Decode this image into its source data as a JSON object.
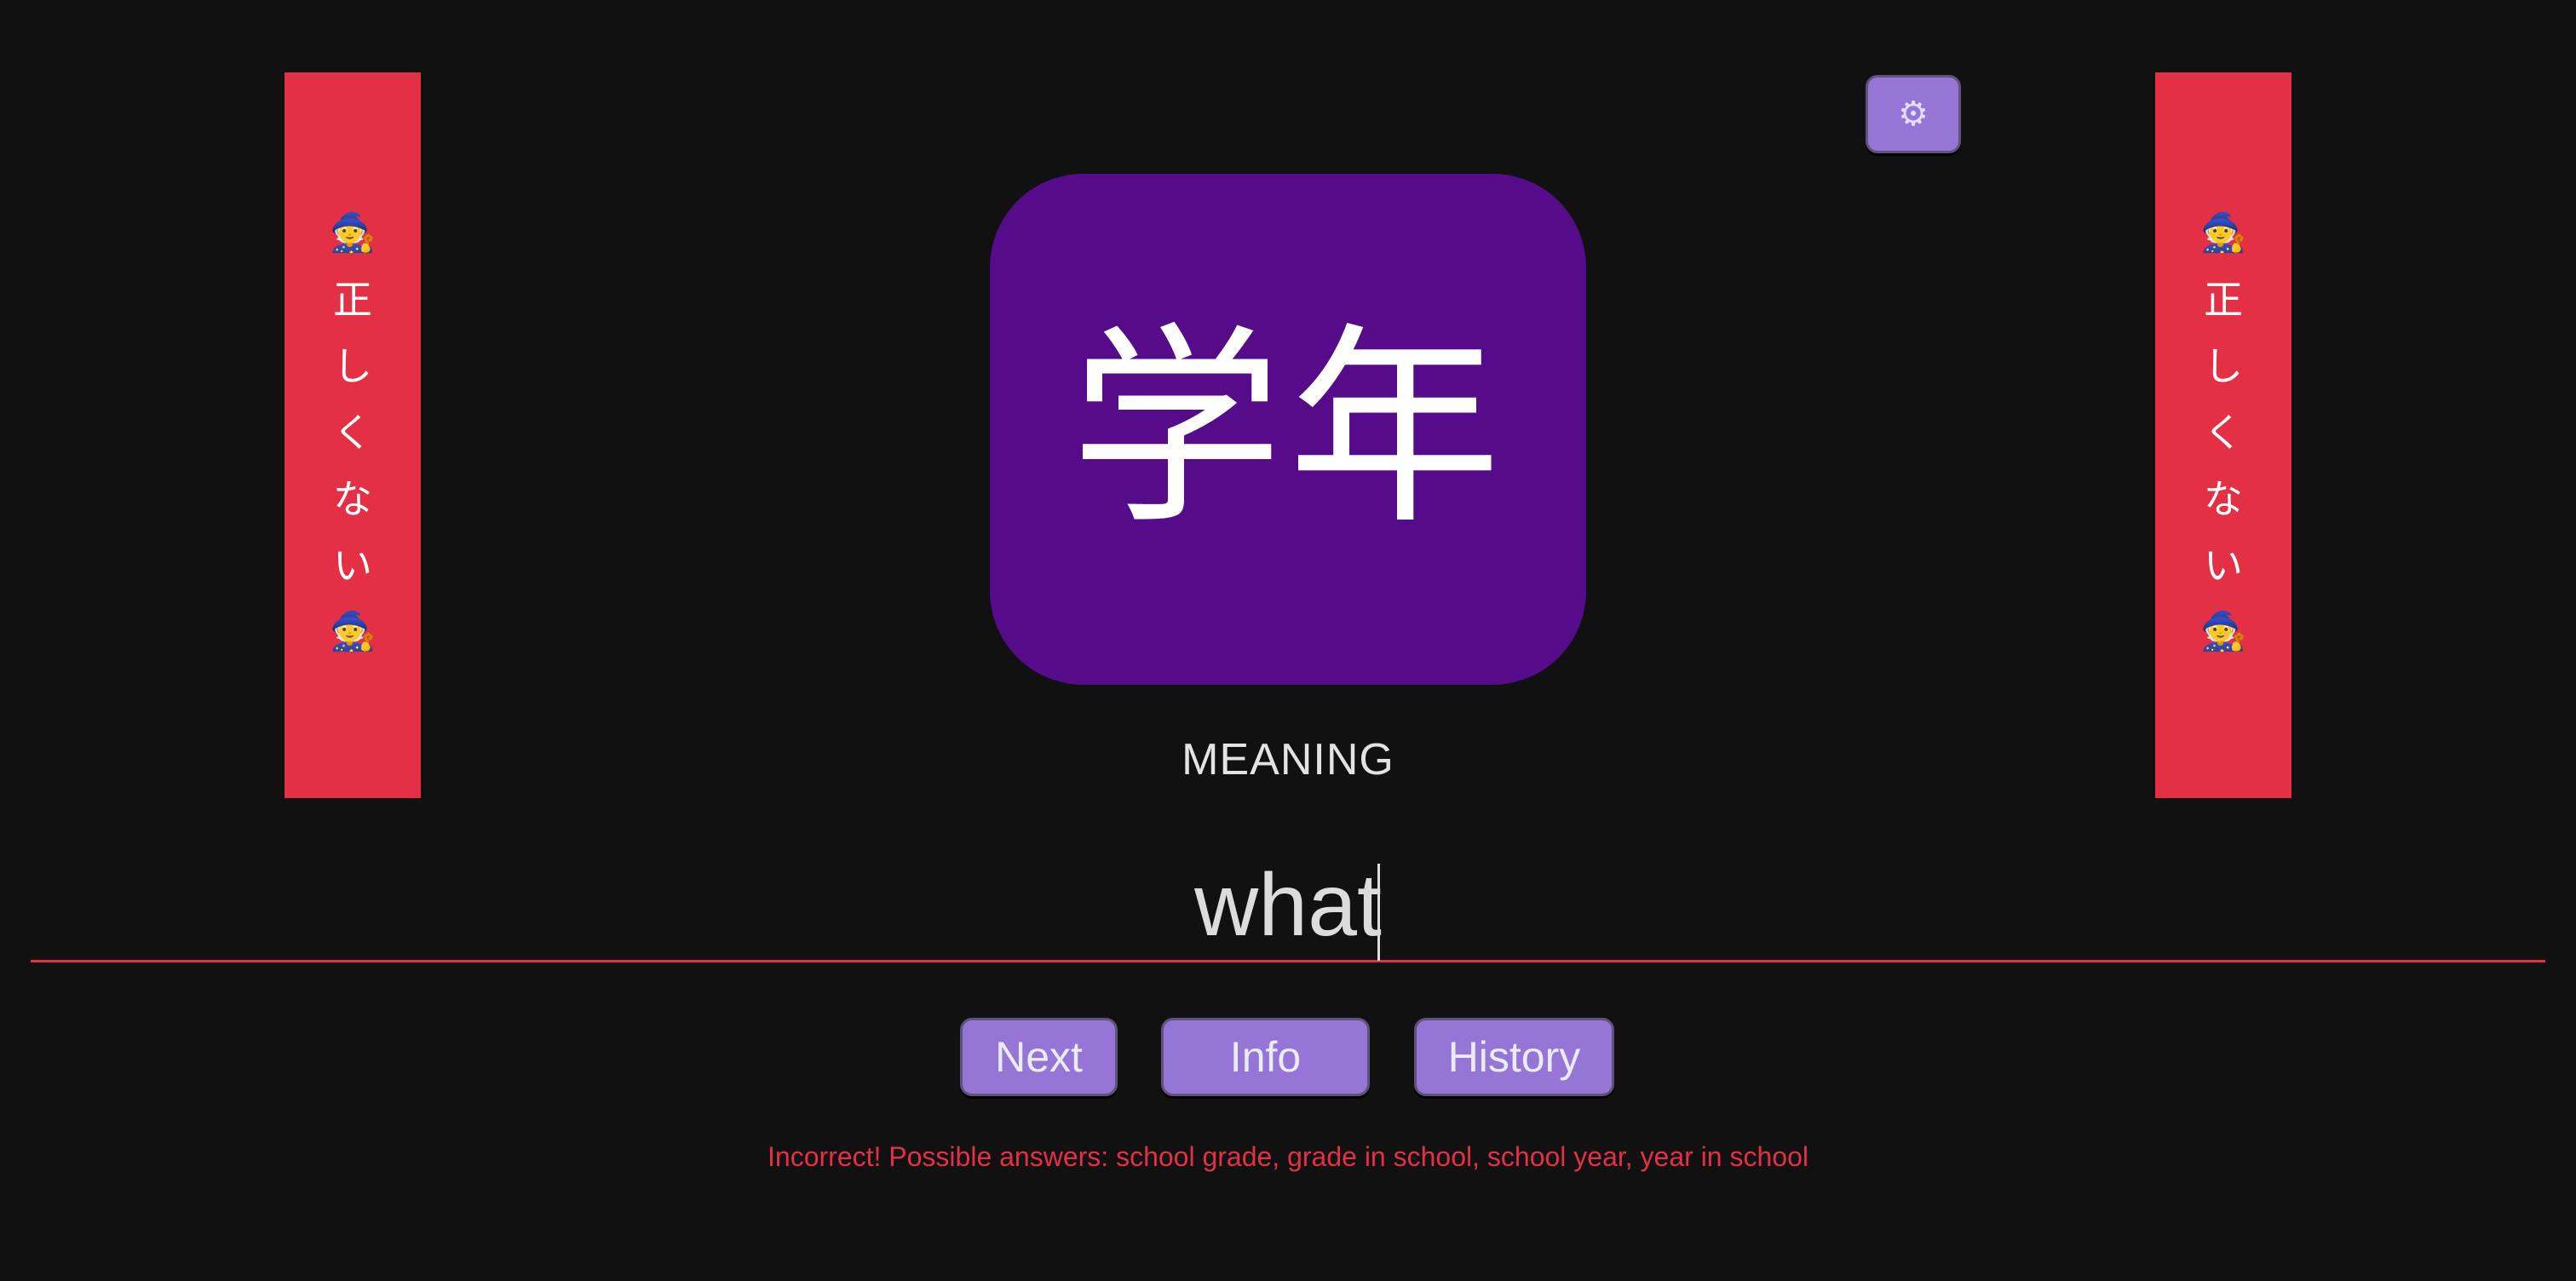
{
  "banner": {
    "emoji": "🧙",
    "chars": [
      "正",
      "し",
      "く",
      "な",
      "い"
    ]
  },
  "settings": {
    "icon": "gear-icon",
    "glyph": "⚙"
  },
  "card": {
    "kanji": "学年"
  },
  "prompt": {
    "label": "MEANING"
  },
  "answer": {
    "value": "what"
  },
  "buttons": {
    "next": "Next",
    "info": "Info",
    "history": "History"
  },
  "feedback": {
    "text": "Incorrect! Possible answers: school grade, grade in school, school year, year in school"
  },
  "colors": {
    "background": "#111111",
    "banner": "#e33045",
    "card": "#560c8a",
    "button": "#9575d6",
    "error": "#e33045"
  }
}
